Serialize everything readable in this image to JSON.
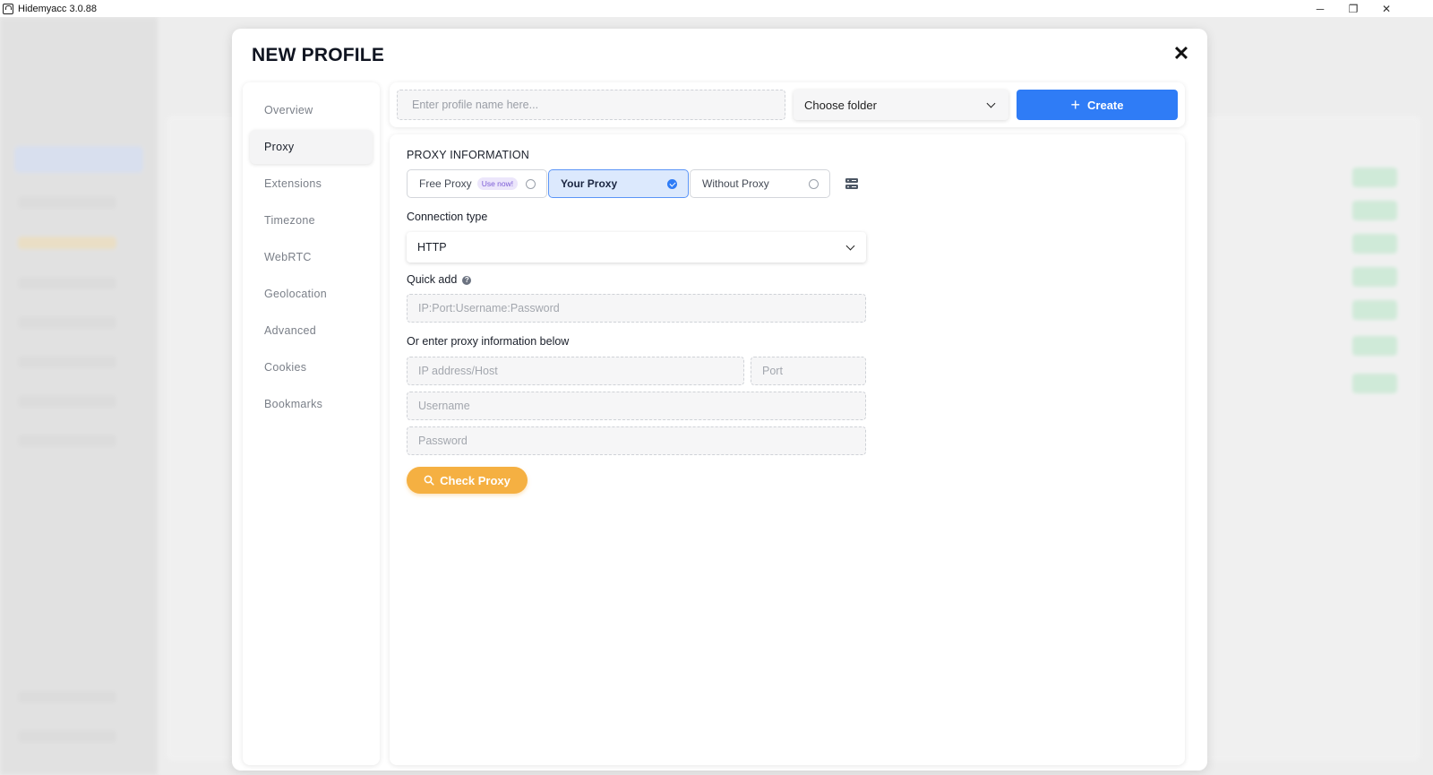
{
  "window": {
    "title": "Hidemyacc 3.0.88",
    "controls": {
      "minimize": "─",
      "restore": "❐",
      "close": "✕"
    }
  },
  "modal": {
    "title": "NEW PROFILE",
    "close_label": "✕"
  },
  "tabs": [
    {
      "label": "Overview",
      "active": false
    },
    {
      "label": "Proxy",
      "active": true
    },
    {
      "label": "Extensions",
      "active": false
    },
    {
      "label": "Timezone",
      "active": false
    },
    {
      "label": "WebRTC",
      "active": false
    },
    {
      "label": "Geolocation",
      "active": false
    },
    {
      "label": "Advanced",
      "active": false
    },
    {
      "label": "Cookies",
      "active": false
    },
    {
      "label": "Bookmarks",
      "active": false
    }
  ],
  "topbar": {
    "profile_name_placeholder": "Enter profile name here...",
    "profile_name_value": "",
    "folder_select_value": "Choose folder",
    "create_label": "Create",
    "create_icon": "plus-icon"
  },
  "proxy": {
    "section_title": "PROXY INFORMATION",
    "types": [
      {
        "label": "Free Proxy",
        "badge": "Use now!",
        "selected": false
      },
      {
        "label": "Your Proxy",
        "badge": "",
        "selected": true
      },
      {
        "label": "Without Proxy",
        "badge": "",
        "selected": false
      }
    ],
    "connection_type_label": "Connection type",
    "connection_type_value": "HTTP",
    "quick_add_label": "Quick add",
    "quick_add_placeholder": "IP:Port:Username:Password",
    "manual_label": "Or enter proxy information below",
    "host_placeholder": "IP address/Host",
    "port_placeholder": "Port",
    "username_placeholder": "Username",
    "password_placeholder": "Password",
    "check_label": "Check Proxy"
  },
  "colors": {
    "accent": "#2f7cf6",
    "check_button": "#f5b042",
    "active_tab_bg": "#f4f4f5",
    "selected_type_bg": "#dce9fd"
  }
}
